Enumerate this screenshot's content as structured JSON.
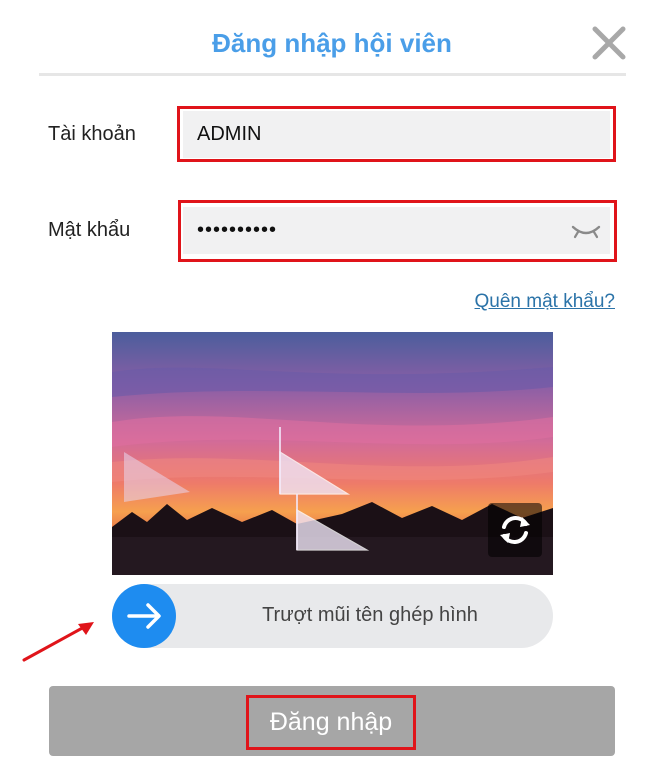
{
  "dialog": {
    "title": "Đăng nhập hội viên",
    "close_icon": "close-icon"
  },
  "form": {
    "username_label": "Tài khoản",
    "username_value": "ADMIN",
    "password_label": "Mật khẩu",
    "password_value": "••••••••••",
    "password_toggle_icon": "eye-closed-icon",
    "forgot_link": "Quên mật khẩu?"
  },
  "captcha": {
    "image": "sunset-landscape-puzzle",
    "refresh_icon": "refresh-icon",
    "slider_text": "Trượt mũi tên ghép hình",
    "handle_icon": "arrow-right-icon"
  },
  "submit": {
    "label": "Đăng nhập"
  },
  "colors": {
    "title": "#4a9ee8",
    "highlight": "#e0141a",
    "slider_handle": "#1e8cf0",
    "button": "#a6a6a6",
    "link": "#2b73a8"
  }
}
